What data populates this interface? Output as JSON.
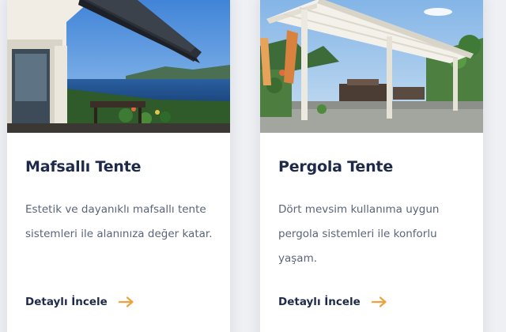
{
  "cards": [
    {
      "title": "Mafsallı Tente",
      "description": "Estetik ve dayanıklı mafsallı tente sistemleri ile alanınıza değer katar.",
      "link_label": "Detaylı İncele",
      "image_icon": "awning-photo"
    },
    {
      "title": "Pergola Tente",
      "description": "Dört mevsim kullanıma uygun pergola sistemleri ile konforlu yaşam.",
      "link_label": "Detaylı İncele",
      "image_icon": "pergola-photo"
    }
  ],
  "colors": {
    "title": "#1e2a4a",
    "text": "#5b6478",
    "accent": "#f2a03d"
  }
}
